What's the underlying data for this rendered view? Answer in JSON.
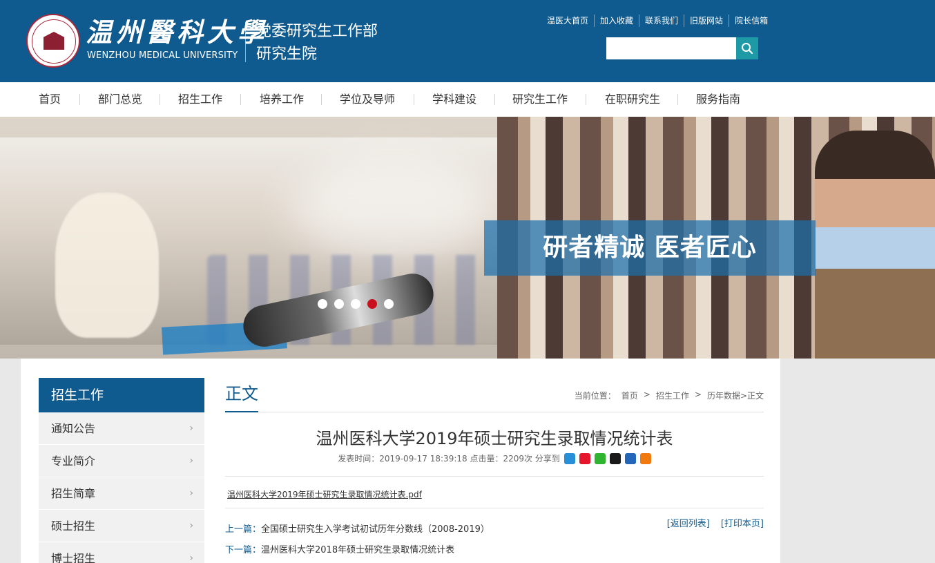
{
  "header": {
    "university_cn": "温州醫科大學",
    "university_en": "WENZHOU MEDICAL UNIVERSITY",
    "dept_line1": "党委研究生工作部",
    "dept_line2": "研究生院",
    "top_links": [
      "温医大首页",
      "加入收藏",
      "联系我们",
      "旧版网站",
      "院长信箱"
    ],
    "search_placeholder": ""
  },
  "nav": [
    "首页",
    "部门总览",
    "招生工作",
    "培养工作",
    "学位及导师",
    "学科建设",
    "研究生工作",
    "在职研究生",
    "服务指南"
  ],
  "banner": {
    "slogan": "研者精诚 医者匠心",
    "slides_total": 5,
    "active_slide": 4
  },
  "sidebar": {
    "title": "招生工作",
    "items": [
      "通知公告",
      "专业简介",
      "招生简章",
      "硕士招生",
      "博士招生"
    ]
  },
  "main": {
    "section_title": "正文",
    "breadcrumb": [
      "当前位置：",
      "首页",
      ">",
      "招生工作",
      ">",
      "历年数据>正文"
    ],
    "article_title": "温州医科大学2019年硕士研究生录取情况统计表",
    "meta": "发表时间：2019-09-17 18:39:18 点击量：2209次 分享到",
    "attachment": "温州医科大学2019年硕士研究生录取情况统计表.pdf",
    "back_to_list": "[返回列表]",
    "print_page": "[打印本页]",
    "prev_label": "上一篇：",
    "prev_title": "全国硕士研究生入学考试初试历年分数线（2008-2019）",
    "next_label": "下一篇：",
    "next_title": "温州医科大学2018年硕士研究生录取情况统计表"
  },
  "colors": {
    "primary": "#0f5a8e",
    "search_button": "#1e9aa6",
    "active_dot": "#c8101f"
  }
}
